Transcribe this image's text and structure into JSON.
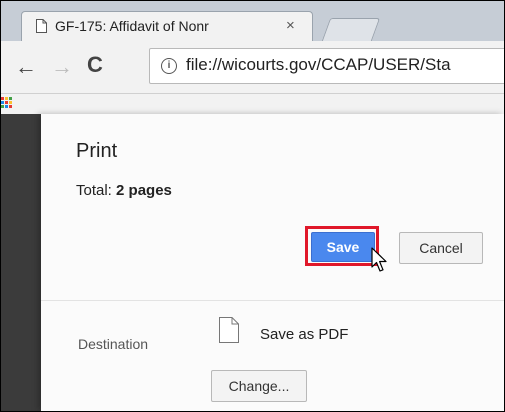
{
  "browser": {
    "tab_title": "GF-175: Affidavit of Nonr",
    "tab_close": "×",
    "url": "file://wicourts.gov/CCAP/USER/Sta"
  },
  "dialog": {
    "title": "Print",
    "total_label": "Total:",
    "total_value": "2 pages",
    "save_label": "Save",
    "cancel_label": "Cancel",
    "destination_label": "Destination",
    "destination_value": "Save as PDF",
    "change_label": "Change..."
  },
  "colors": {
    "save_button": "#4a88ee",
    "highlight": "#e0182a"
  }
}
